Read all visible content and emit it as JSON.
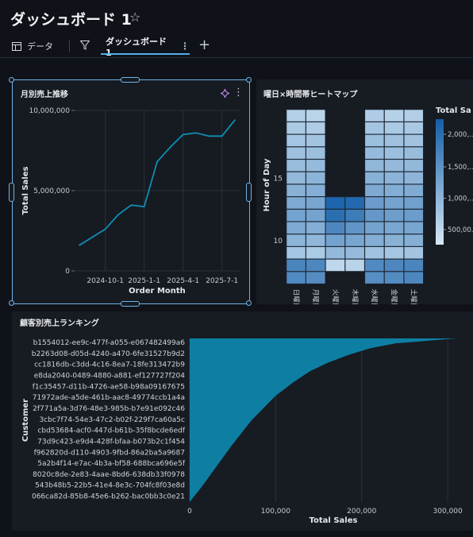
{
  "header": {
    "title": "ダッシュボード 1",
    "data_tab": "データ",
    "dashboard_tab": "ダッシュボード 1"
  },
  "panels": {
    "monthly": {
      "title": "月別売上推移",
      "chart_data": {
        "type": "line",
        "title": "月別売上推移",
        "xlabel": "Order Month",
        "ylabel": "Total Sales",
        "x": [
          "2024-8-1",
          "2024-9-1",
          "2024-10-1",
          "2024-11-1",
          "2024-12-1",
          "2025-1-1",
          "2025-2-1",
          "2025-3-1",
          "2025-4-1",
          "2025-5-1",
          "2025-6-1",
          "2025-7-1",
          "2025-8-1"
        ],
        "values": [
          1600000,
          2100000,
          2600000,
          3500000,
          4100000,
          4000000,
          6800000,
          7700000,
          8500000,
          8600000,
          8400000,
          8400000,
          9400000
        ],
        "x_ticks": [
          "2024-10-1",
          "2025-1-1",
          "2025-4-1",
          "2025-7-1"
        ],
        "y_ticks": [
          "10,000,000",
          "5,000,000",
          "0"
        ],
        "ylim": [
          0,
          10000000
        ],
        "grid": true,
        "color": "#0e8fb4"
      }
    },
    "heatmap": {
      "title": "曜日×時間帯ヒートマップ",
      "chart_data": {
        "type": "heatmap",
        "title": "曜日×時間帯ヒートマップ",
        "xlabel": "",
        "ylabel": "Hour of Day",
        "categories": [
          "日曜日",
          "月曜日",
          "火曜日",
          "木曜日",
          "水曜日",
          "金曜日",
          "土曜日"
        ],
        "y_ticks": [
          "15",
          "10"
        ],
        "legend_title": "Total Sa",
        "legend_ticks": [
          "2,000,...",
          "1,500,...",
          "1,000,...",
          "500,00..."
        ],
        "colormap": [
          "#d6e8f5",
          "#135ea8"
        ],
        "hours": [
          20,
          19,
          18,
          17,
          16,
          15,
          14,
          13,
          12,
          11,
          10,
          9,
          8,
          7
        ],
        "matrix": [
          [
            0.18,
            0.15,
            null,
            null,
            0.2,
            0.17,
            0.19
          ],
          [
            0.22,
            0.2,
            null,
            null,
            0.25,
            0.22,
            0.23
          ],
          [
            0.25,
            0.26,
            null,
            null,
            0.3,
            0.28,
            0.27
          ],
          [
            0.28,
            0.3,
            null,
            null,
            0.33,
            0.3,
            0.32
          ],
          [
            0.32,
            0.33,
            null,
            null,
            0.36,
            0.34,
            0.35
          ],
          [
            0.35,
            0.38,
            null,
            null,
            0.4,
            0.38,
            0.37
          ],
          [
            0.4,
            0.42,
            null,
            null,
            0.45,
            0.43,
            0.44
          ],
          [
            0.45,
            0.48,
            0.95,
            0.92,
            0.55,
            0.5,
            0.52
          ],
          [
            0.5,
            0.5,
            0.88,
            0.78,
            0.58,
            0.54,
            0.55
          ],
          [
            0.45,
            0.42,
            0.7,
            0.6,
            0.5,
            0.47,
            0.48
          ],
          [
            0.38,
            0.36,
            0.5,
            0.48,
            0.42,
            0.4,
            0.41
          ],
          [
            0.25,
            0.22,
            0.35,
            0.33,
            0.27,
            0.25,
            0.26
          ],
          [
            0.72,
            0.7,
            0.12,
            0.15,
            0.68,
            0.7,
            0.72
          ],
          [
            0.68,
            0.66,
            null,
            null,
            0.65,
            0.67,
            0.7
          ]
        ]
      }
    },
    "ranking": {
      "title": "顧客別売上ランキング",
      "chart_data": {
        "type": "area",
        "title": "顧客別売上ランキング",
        "xlabel": "Total Sales",
        "ylabel": "Customer",
        "x_ticks": [
          "0",
          "100,000",
          "200,000",
          "300,000"
        ],
        "xlim": [
          0,
          310000
        ],
        "categories": [
          "b1554012-ee9c-477f-a055-e067482499a6",
          "b2263d08-d05d-4240-a470-6fe31527b9d2",
          "cc1816db-c3dd-4c16-8ea7-18fe313472b9",
          "e8da2040-0489-4880-a881-ef127727f204",
          "f1c35457-d11b-4726-ae58-b98a09167675",
          "71972ade-a5de-461b-aac8-49774ccb1a4a",
          "2f771a5a-3d76-48e3-985b-b7e91e092c46",
          "3cbc7f74-54e3-47c2-b02f-229f7ca60a5c",
          "cbd53684-acf0-447d-b61b-35f8bcde6edf",
          "73d9c423-e9d4-428f-bfaa-b073b2c1f454",
          "f962820d-d110-4903-9fbd-86a2ba5a9687",
          "5a2b4f14-e7ac-4b3a-bf58-688bca696e5f",
          "8020c8de-2e83-4aae-8bd6-638db33f0978",
          "543b48b5-22b5-41e4-8e3c-704fc8f03e8d",
          "066ca82d-85b8-45e6-b262-bac0bb3c0e21"
        ],
        "values": [
          [
            0,
            310000
          ],
          [
            0.03,
            240000
          ],
          [
            0.06,
            210000
          ],
          [
            0.1,
            185000
          ],
          [
            0.15,
            160000
          ],
          [
            0.2,
            140000
          ],
          [
            0.27,
            120000
          ],
          [
            0.35,
            100000
          ],
          [
            0.43,
            85000
          ],
          [
            0.5,
            72000
          ],
          [
            0.58,
            60000
          ],
          [
            0.66,
            48000
          ],
          [
            0.74,
            37000
          ],
          [
            0.82,
            26000
          ],
          [
            0.9,
            15000
          ],
          [
            0.96,
            6000
          ],
          [
            1.0,
            0
          ]
        ],
        "grid": true,
        "color": "#0e7fa2"
      }
    }
  }
}
